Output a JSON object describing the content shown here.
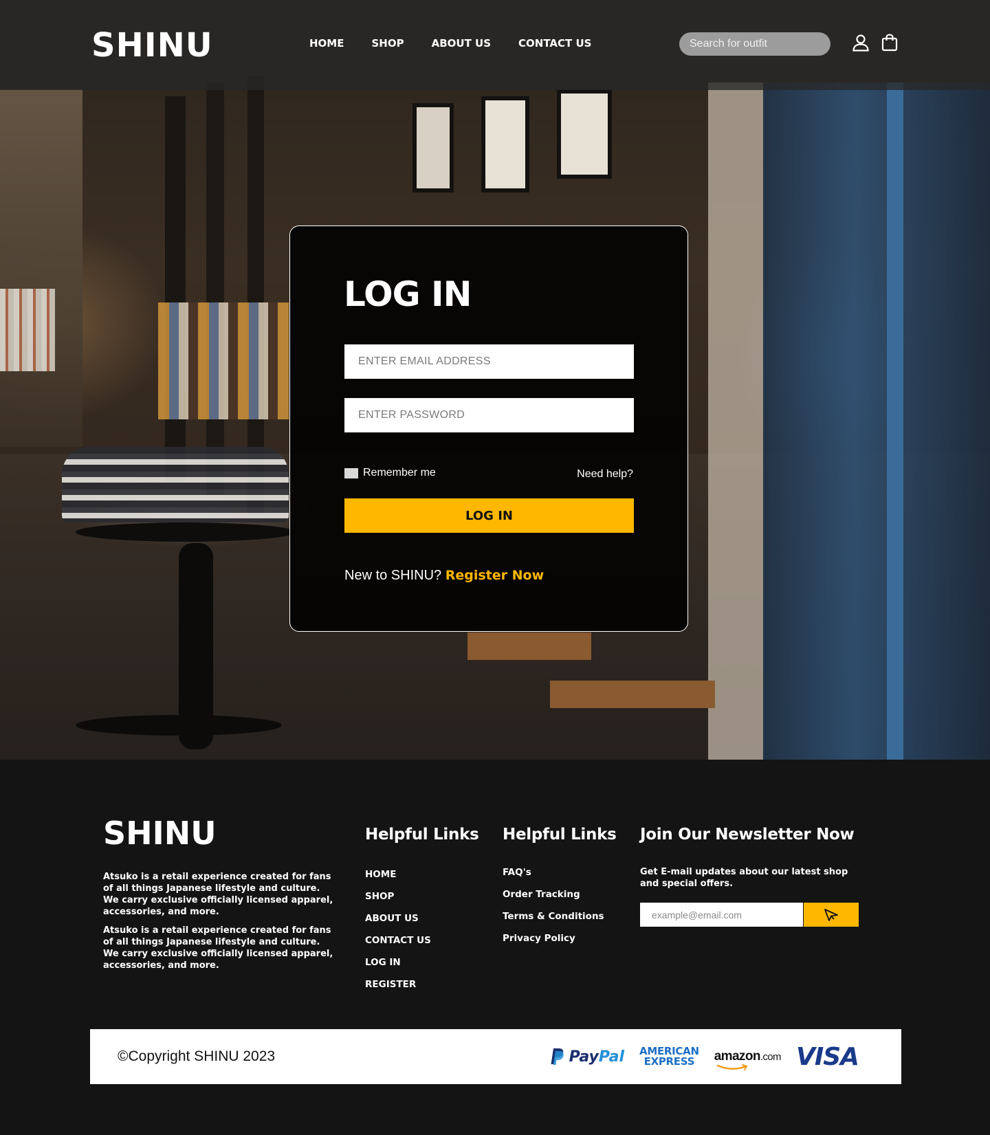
{
  "brand": "SHINU",
  "nav": {
    "links": [
      "HOME",
      "SHOP",
      "ABOUT US",
      "CONTACT US"
    ],
    "search_placeholder": "Search for outfit",
    "icons": [
      "user-icon",
      "shopping-bag-icon"
    ]
  },
  "login": {
    "title": "LOG IN",
    "email_placeholder": "ENTER EMAIL ADDRESS",
    "password_placeholder": "ENTER PASSWORD",
    "remember_label": "Remember me",
    "need_help": "Need help?",
    "submit_label": "LOG IN",
    "register_prompt": "New to SHINU?",
    "register_link": "Register Now"
  },
  "footer": {
    "brand": "SHINU",
    "about": [
      "Atsuko is a retail experience created for fans of all things Japanese lifestyle and culture. We carry exclusive officially licensed apparel, accessories, and more.",
      "Atsuko is a retail experience created for fans of all things Japanese lifestyle and culture. We carry exclusive officially licensed apparel, accessories, and more."
    ],
    "col1": {
      "title": "Helpful Links",
      "links": [
        "HOME",
        "SHOP",
        "ABOUT US",
        "CONTACT US",
        "LOG IN",
        "REGISTER"
      ]
    },
    "col2": {
      "title": "Helpful Links",
      "links": [
        "FAQ's",
        "Order Tracking",
        "Terms & Conditions",
        "Privacy Policy"
      ]
    },
    "newsletter": {
      "title": "Join Our Newsletter Now",
      "text": "Get E-mail updates about our latest shop and special offers.",
      "placeholder": "example@email.com",
      "send_icon": "send-cursor-icon"
    },
    "copyright": "©Copyright SHINU 2023",
    "payments": {
      "paypal_pay": "Pay",
      "paypal_pal": "Pal",
      "amex_line1": "AMERICAN",
      "amex_line2": "EXPRESS",
      "amazon": "amazon",
      "amazon_tld": ".com",
      "visa": "VISA"
    }
  },
  "colors": {
    "accent": "#ffb700",
    "footer_bg": "#141414",
    "card_bg": "#000000"
  }
}
